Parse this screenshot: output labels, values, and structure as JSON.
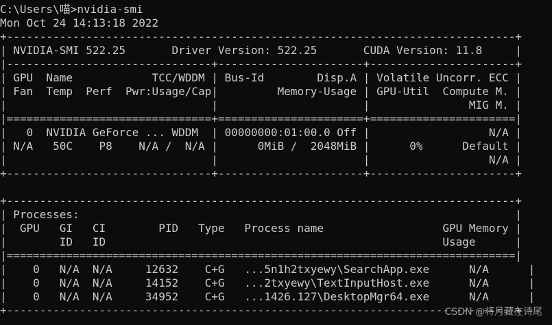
{
  "terminal": {
    "lines": [
      "C:\\Users\\喵>nvidia-smi",
      "Mon Oct 24 14:13:18 2022",
      "+-----------------------------------------------------------------------------+",
      "| NVIDIA-SMI 522.25       Driver Version: 522.25       CUDA Version: 11.8     |",
      "|-------------------------------+----------------------+----------------------+",
      "| GPU  Name            TCC/WDDM | Bus-Id        Disp.A | Volatile Uncorr. ECC |",
      "| Fan  Temp  Perf  Pwr:Usage/Cap|         Memory-Usage | GPU-Util  Compute M. |",
      "|                               |                      |               MIG M. |",
      "|===============================+======================+======================|",
      "|   0  NVIDIA GeForce ... WDDM  | 00000000:01:00.0 Off |                  N/A |",
      "| N/A   50C    P8    N/A /  N/A |      0MiB /  2048MiB |      0%      Default |",
      "|                               |                      |                  N/A |",
      "+-------------------------------+----------------------+----------------------+",
      "",
      "+-----------------------------------------------------------------------------+",
      "| Processes:                                                                  |",
      "|  GPU   GI   CI        PID   Type   Process name                  GPU Memory |",
      "|        ID   ID                                                   Usage      |",
      "|=============================================================================|",
      "|    0   N/A  N/A     12632    C+G   ...5n1h2txyewy\\SearchApp.exe      N/A      |",
      "|    0   N/A  N/A     14152    C+G   ...2txyewy\\TextInputHost.exe      N/A      |",
      "|    0   N/A  N/A     34952    C+G   ...1426.127\\DesktopMgr64.exe      N/A      |",
      "+-----------------------------------------------------------------------------+"
    ],
    "watermark": "CSDN @将月藏在诗尾"
  },
  "colors": {
    "background": "#0c0c0c",
    "foreground": "#cccccc"
  }
}
